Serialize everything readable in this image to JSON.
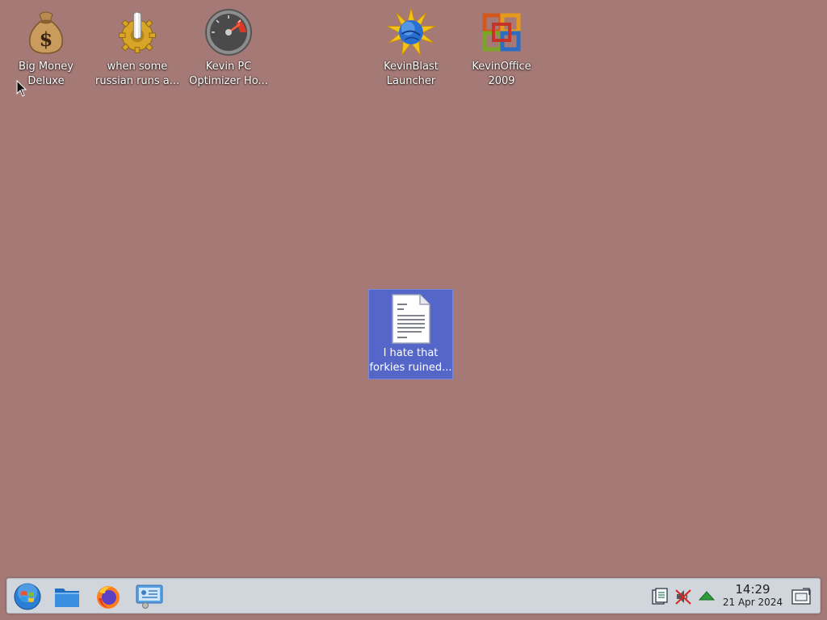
{
  "desktop": {
    "background_color": "#a57a76",
    "icons": [
      {
        "name": "big-money-deluxe",
        "icon": "money-bag-icon",
        "label_line1": "Big Money",
        "label_line2": "Deluxe",
        "selected": false
      },
      {
        "name": "when-some-russian",
        "icon": "gear-icon",
        "label_line1": "when some",
        "label_line2": "russian runs a...",
        "selected": false
      },
      {
        "name": "kevin-pc-optimizer",
        "icon": "speedometer-icon",
        "label_line1": "Kevin PC",
        "label_line2": "Optimizer Ho...",
        "selected": false
      },
      {
        "name": "kevinblast-launcher",
        "icon": "globe-burst-icon",
        "label_line1": "KevinBlast",
        "label_line2": "Launcher",
        "selected": false
      },
      {
        "name": "kevinoffice-2009",
        "icon": "office-logo-icon",
        "label_line1": "KevinOffice",
        "label_line2": "2009",
        "selected": false
      },
      {
        "name": "text-document",
        "icon": "text-document-icon",
        "label_line1": "I hate that",
        "label_line2": "forkies ruined...",
        "selected": true
      }
    ]
  },
  "taskbar": {
    "launchers": [
      {
        "name": "start-menu",
        "icon": "windows-orb-icon"
      },
      {
        "name": "file-manager",
        "icon": "folder-icon"
      },
      {
        "name": "firefox",
        "icon": "firefox-icon"
      },
      {
        "name": "control-panel",
        "icon": "control-panel-icon"
      }
    ],
    "tray": [
      {
        "name": "clipboard",
        "icon": "clipboard-icon"
      },
      {
        "name": "audio-muted",
        "icon": "speaker-muted-icon"
      },
      {
        "name": "updates",
        "icon": "green-arrow-up-icon"
      }
    ],
    "clock": {
      "time": "14:29",
      "date": "21 Apr 2024"
    },
    "show_desktop_icon": "show-desktop-icon"
  },
  "colors": {
    "selection": "#5467c9",
    "taskbar": "#d1d5dc"
  }
}
